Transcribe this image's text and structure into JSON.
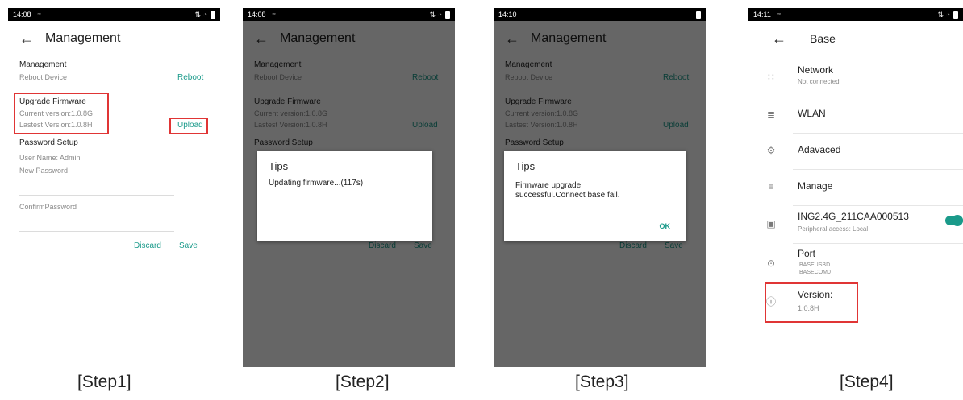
{
  "status": {
    "s1_time": "14:08",
    "s2_time": "14:08",
    "s3_time": "14:10",
    "s4_time": "14:11",
    "dim_icon": "≈",
    "right_icons": "⇅ ◔"
  },
  "management": {
    "back_glyph": "←",
    "title": "Management",
    "section_management": "Management",
    "reboot_device": "Reboot Device",
    "reboot_button": "Reboot",
    "section_upgrade": "Upgrade Firmware",
    "current_version": "Current version:1.0.8G",
    "latest_version": "Lastest Version:1.0.8H",
    "upload_button": "Upload",
    "section_password": "Password Setup",
    "user_name": "User Name: Admin",
    "new_password_placeholder": "New Password",
    "confirm_password_placeholder": "ConfirmPassword",
    "discard_button": "Discard",
    "save_button": "Save"
  },
  "dialog_step2": {
    "title": "Tips",
    "message": "Updating firmware...(117s)"
  },
  "dialog_step3": {
    "title": "Tips",
    "message_line1": "Firmware upgrade",
    "message_line2": "successful.Connect base fail.",
    "ok_button": "OK"
  },
  "base": {
    "back_glyph": "←",
    "title": "Base",
    "network_title": "Network",
    "network_sub": "Not connected",
    "wlan_title": "WLAN",
    "advanced_title": "Adavaced",
    "manage_title": "Manage",
    "device_title": "ING2.4G_211CAA000513",
    "device_sub": "Peripheral access: Local",
    "device_toggle_on": true,
    "port_title": "Port",
    "port_sub1": "BASEUSBD",
    "port_sub2": "BASECOM0",
    "version_title": "Version:",
    "version_value": "1.0.8H"
  },
  "icons": {
    "network": "∷",
    "wlan": "≣",
    "advanced": "⚙",
    "manage": "≡",
    "device": "▣",
    "port": "⊙",
    "version": "ⓘ"
  },
  "captions": {
    "step1": "[Step1]",
    "step2": "[Step2]",
    "step3": "[Step3]",
    "step4": "[Step4]"
  },
  "colors": {
    "accent": "#1a9a8a",
    "highlight": "#e03535",
    "overlay": "#5a5a5a"
  }
}
